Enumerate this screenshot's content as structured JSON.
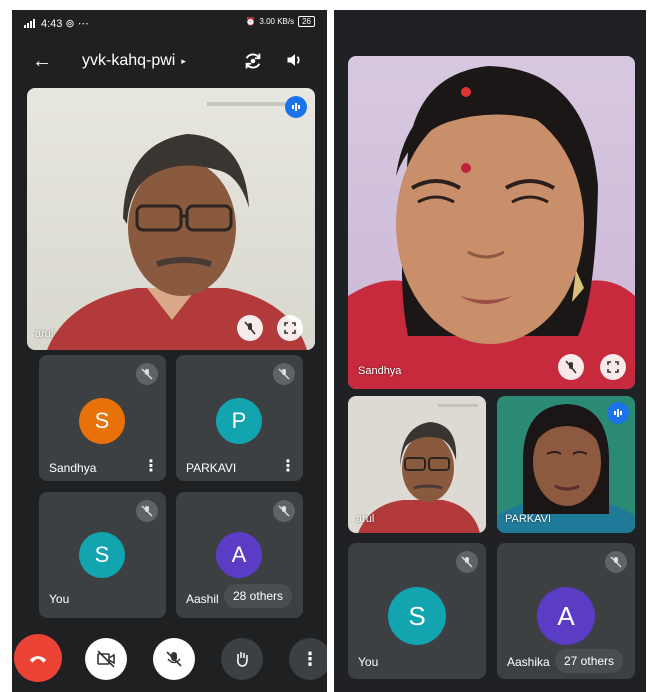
{
  "left": {
    "status_bar": {
      "time": "4:43",
      "extra": "⊚ ⋯",
      "net_speed": "3.00 KB/s",
      "battery": "26"
    },
    "top_bar": {
      "back_icon": "back-arrow-icon",
      "meeting_code": "yvk-kahq-pwi",
      "expand": "▸"
    },
    "main_video": {
      "name": "arul"
    },
    "participants": [
      {
        "name": "Sandhya",
        "initial": "S",
        "color": "#e8710a"
      },
      {
        "name": "PARKAVI",
        "initial": "P",
        "color": "#12a4af"
      },
      {
        "name": "You",
        "initial": "S",
        "color": "#12a4af"
      },
      {
        "name": "Aashil",
        "initial": "A",
        "color": "#5b3cc4"
      }
    ],
    "others_label": "28 others",
    "controls": [
      "end-call",
      "camera-off",
      "mic-off",
      "raise-hand",
      "more"
    ]
  },
  "right": {
    "main_video": {
      "name": "Sandhya"
    },
    "small_videos": [
      {
        "name": "arul"
      },
      {
        "name": "PARKAVI"
      }
    ],
    "participants": [
      {
        "name": "You",
        "initial": "S",
        "color": "#12a4af"
      },
      {
        "name": "Aashika",
        "initial": "A",
        "color": "#5b3cc4"
      }
    ],
    "others_label": "27 others"
  },
  "colors": {
    "end_call": "#ea4335",
    "tile_bg": "#3c4043",
    "bg": "#202124",
    "accent": "#1a73e8"
  }
}
